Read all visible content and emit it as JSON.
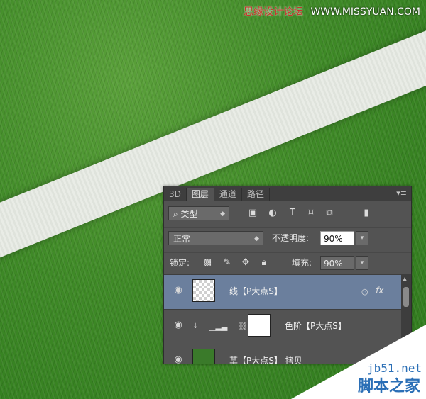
{
  "watermark": {
    "top_cn": "思缘设计论坛",
    "top_url": "WWW.MISSYUAN.COM",
    "corner_domain": "jb51.net",
    "corner_name": "脚本之家"
  },
  "layers_panel": {
    "tabs": [
      "3D",
      "图层",
      "通道",
      "路径"
    ],
    "active_tab": "图层",
    "filter_kind": "类型",
    "blend_mode": "正常",
    "opacity_label": "不透明度:",
    "opacity_value": "90%",
    "lock_label": "锁定:",
    "fill_label": "填充:",
    "fill_value": "90%",
    "layers": [
      {
        "name": "线【P大点S】",
        "thumb": "transparent",
        "selected": true,
        "fx": "fx"
      },
      {
        "name": "色阶【P大点S】",
        "thumb": "white-mask",
        "selected": false
      },
      {
        "name": "草【P大点S】 拷贝",
        "thumb": "grass",
        "selected": false
      }
    ]
  },
  "icons": {
    "filter_icons": [
      "image-icon",
      "adjustment-icon",
      "type-icon",
      "shape-icon",
      "smart-object-icon",
      "toggle-filter-icon"
    ],
    "lock_icons": [
      "lock-transparent-icon",
      "lock-paint-icon",
      "lock-move-icon",
      "lock-all-icon"
    ]
  }
}
